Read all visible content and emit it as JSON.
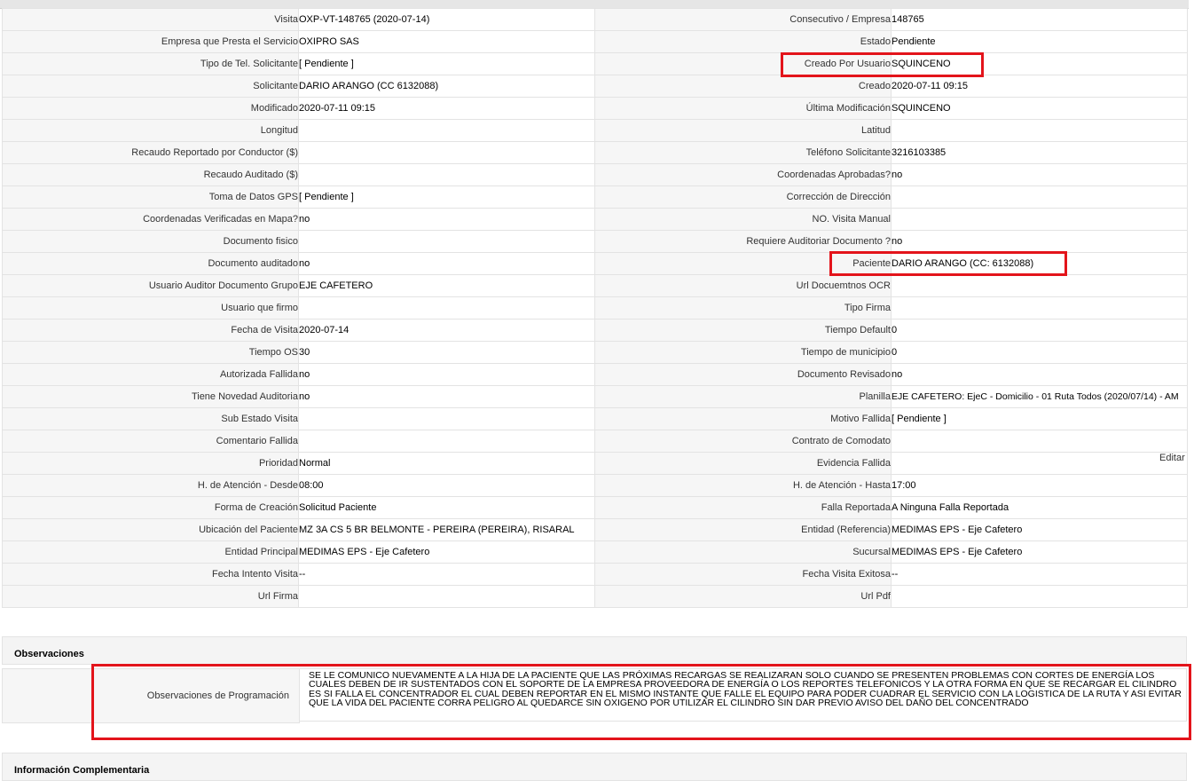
{
  "rows": [
    {
      "l1": "Visita",
      "v1": "OXP-VT-148765 (2020-07-14)",
      "l2": "Consecutivo / Empresa",
      "v2": "148765"
    },
    {
      "l1": "Empresa que Presta el Servicio",
      "v1": "OXIPRO SAS",
      "l2": "Estado",
      "v2": "Pendiente"
    },
    {
      "l1": "Tipo de Tel. Solicitante",
      "v1": "[ Pendiente ]",
      "l2": "Creado Por Usuario",
      "v2": "SQUINCENO"
    },
    {
      "l1": "Solicitante",
      "v1": "DARIO ARANGO (CC 6132088)",
      "l2": "Creado",
      "v2": "2020-07-11 09:15"
    },
    {
      "l1": "Modificado",
      "v1": "2020-07-11 09:15",
      "l2": "Última Modificación",
      "v2": " SQUINCENO"
    },
    {
      "l1": "Longitud",
      "v1": "",
      "l2": "Latitud",
      "v2": ""
    },
    {
      "l1": "Recaudo Reportado por Conductor ($)",
      "v1": "",
      "l2": "Teléfono Solicitante",
      "v2": "3216103385"
    },
    {
      "l1": "Recaudo Auditado ($)",
      "v1": "",
      "l2": "Coordenadas Aprobadas?",
      "v2": " no"
    },
    {
      "l1": "Toma de Datos GPS",
      "v1": "[ Pendiente ]",
      "l2": "Corrección de Dirección",
      "v2": ""
    },
    {
      "l1": "Coordenadas Verificadas en Mapa?",
      "v1": " no",
      "l2": "NO. Visita Manual",
      "v2": ""
    },
    {
      "l1": "Documento fisico",
      "v1": "",
      "l2": "Requiere Auditoriar Documento ?",
      "v2": " no"
    },
    {
      "l1": "Documento auditado",
      "v1": " no",
      "l2": "Paciente",
      "v2": "DARIO ARANGO (CC: 6132088)"
    },
    {
      "l1": "Usuario Auditor Documento Grupo",
      "v1": "EJE CAFETERO",
      "l2": "Url Docuemtnos OCR",
      "v2": ""
    },
    {
      "l1": "Usuario que firmo",
      "v1": "",
      "l2": "Tipo Firma",
      "v2": ""
    },
    {
      "l1": "Fecha de Visita",
      "v1": " 2020-07-14",
      "l2": "Tiempo Default",
      "v2": "0"
    },
    {
      "l1": "Tiempo OS",
      "v1": "30",
      "l2": "Tiempo de municipio",
      "v2": "0"
    },
    {
      "l1": "Autorizada Fallida",
      "v1": " no",
      "l2": "Documento Revisado",
      "v2": " no"
    },
    {
      "l1": "Tiene Novedad Auditoria",
      "v1": " no",
      "l2": "Planilla",
      "v2": "EJE CAFETERO: EjeC - Domicilio - 01 Ruta Todos (2020/07/14) - AM"
    },
    {
      "l1": "Sub Estado Visita",
      "v1": "",
      "l2": "Motivo Fallida",
      "v2": "[ Pendiente ]"
    },
    {
      "l1": "Comentario Fallida",
      "v1": "",
      "l2": "Contrato de Comodato",
      "v2": ""
    },
    {
      "l1": "Prioridad",
      "v1": "Normal",
      "l2": "Evidencia Fallida",
      "v2": ""
    },
    {
      "l1": "H. de Atención - Desde",
      "v1": "08:00",
      "l2": "H. de Atención - Hasta",
      "v2": "17:00"
    },
    {
      "l1": "Forma de Creación",
      "v1": "Solicitud Paciente",
      "l2": "Falla Reportada",
      "v2": "A Ninguna Falla Reportada"
    },
    {
      "l1": "Ubicación del Paciente",
      "v1": "MZ 3A CS 5 BR BELMONTE - PEREIRA (PEREIRA), RISARAL",
      "l2": "Entidad (Referencia)",
      "v2": "MEDIMAS EPS - Eje Cafetero"
    },
    {
      "l1": "Entidad Principal",
      "v1": "MEDIMAS EPS - Eje Cafetero",
      "l2": "Sucursal",
      "v2": "MEDIMAS EPS - Eje Cafetero"
    },
    {
      "l1": "Fecha Intento Visita",
      "v1": " --",
      "l2": "Fecha Visita Exitosa",
      "v2": " --"
    },
    {
      "l1": "Url Firma",
      "v1": "",
      "l2": "Url Pdf",
      "v2": ""
    }
  ],
  "editar_label": "Editar",
  "observaciones": {
    "title": "Observaciones",
    "label": "Observaciones de Programación",
    "text": "  SE LE COMUNICO NUEVAMENTE A LA HIJA DE LA PACIENTE QUE LAS PRÓXIMAS RECARGAS SE REALIZARAN SOLO CUANDO SE PRESENTEN PROBLEMAS CON CORTES DE ENERGÍA LOS CUALES DEBEN DE IR SUSTENTADOS CON EL SOPORTE DE LA EMPRESA PROVEEDORA DE ENERGÍA O LOS REPORTES TELEFONICOS Y LA OTRA FORMA EN QUE SE RECARGAR EL CILINDRO ES SI FALLA EL CONCENTRADOR EL CUAL DEBEN REPORTAR EN EL MISMO INSTANTE QUE FALLE EL EQUIPO PARA PODER CUADRAR EL SERVICIO CON LA LOGISTICA DE LA RUTA Y ASI EVITAR QUE LA VIDA DEL PACIENTE CORRA PELIGRO AL QUEDARCE SIN OXIGENO POR UTILIZAR EL CILINDRO SIN DAR PREVIO AVISO DEL DAÑO DEL CONCENTRADO"
  },
  "complementaria": {
    "title": "Información Complementaria"
  },
  "colors": {
    "highlight": "#e3141b",
    "label_bg": "#f6f6f6",
    "border": "#e3e3e3"
  }
}
